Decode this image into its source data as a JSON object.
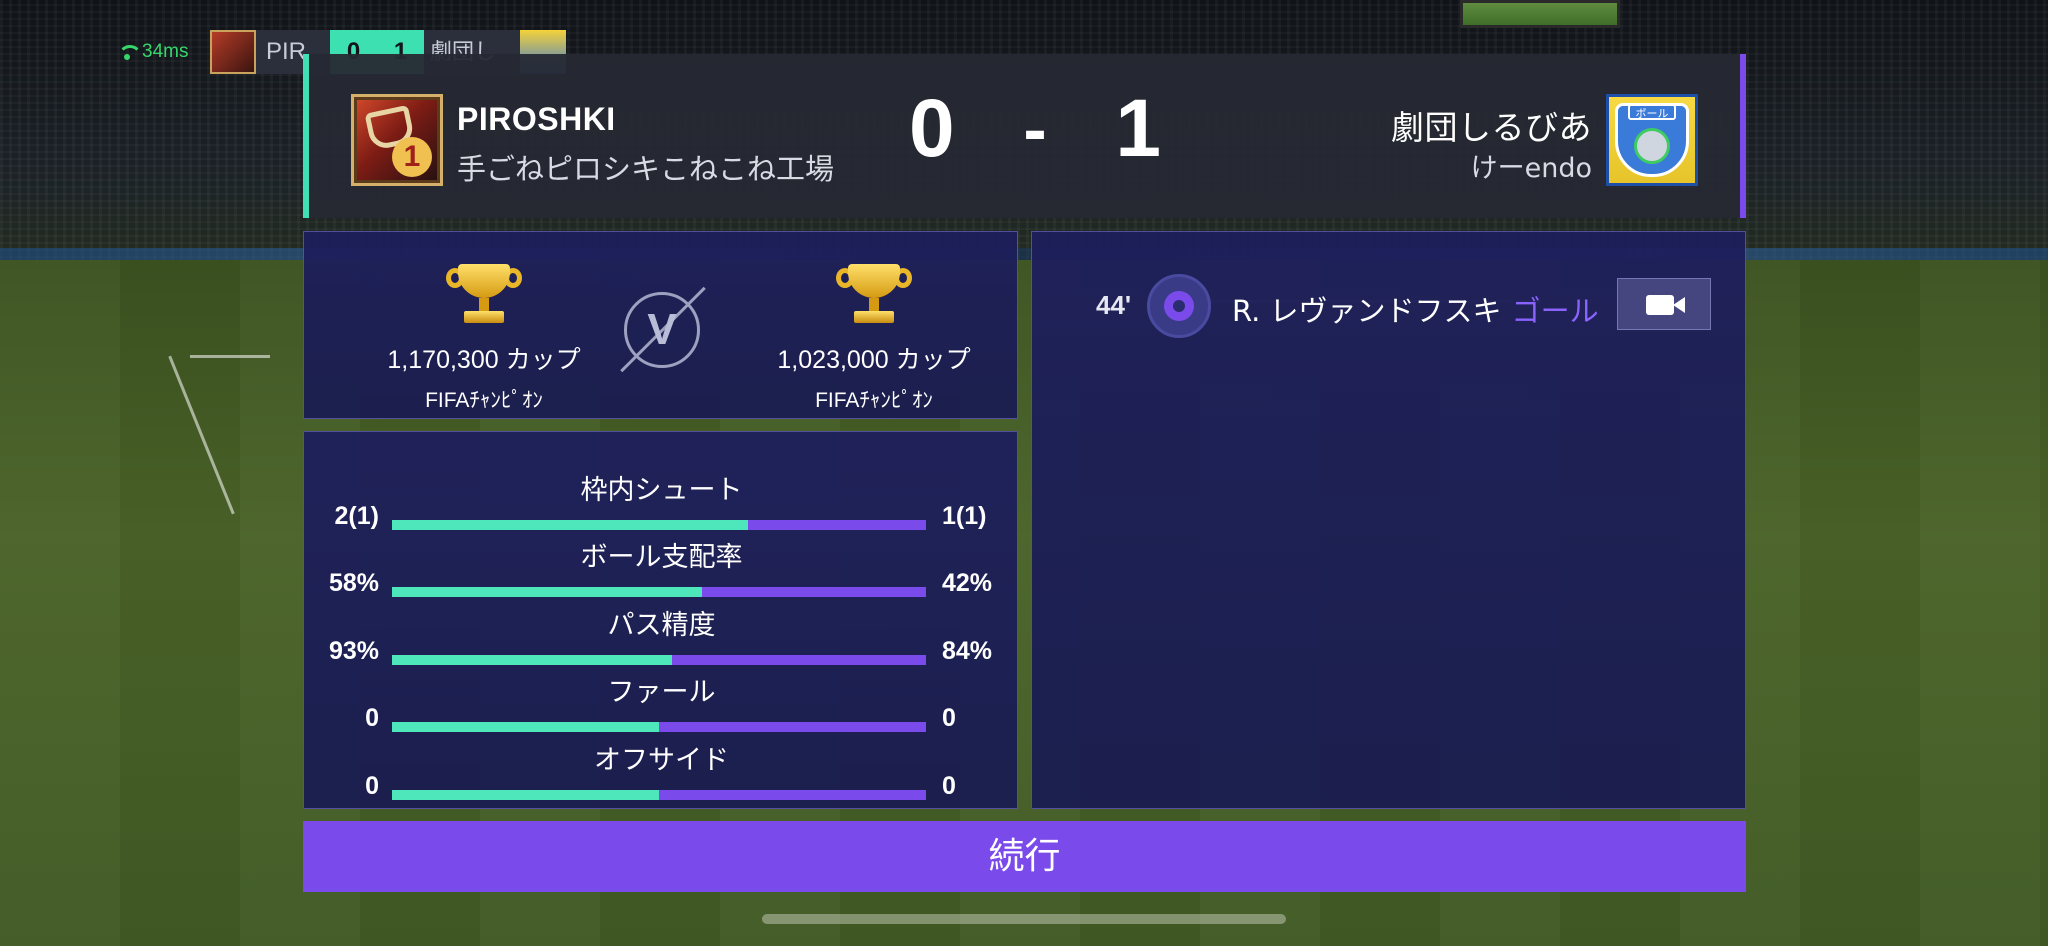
{
  "hud": {
    "ping": "34ms",
    "home_abbr": "PIR",
    "home_score": "0",
    "away_score": "1",
    "away_abbr": "劇団し"
  },
  "header": {
    "home": {
      "name": "PIROSHKI",
      "subtitle": "手ごねピロシキこねこね工場",
      "badge_number": "1"
    },
    "away": {
      "name": "劇団しるびあ",
      "subtitle": "けーendo",
      "badge_tag": "ボール"
    },
    "score": {
      "home": "0",
      "separator": "-",
      "away": "1"
    }
  },
  "cups": {
    "home": {
      "count": "1,170,300 カップ",
      "rank": "FIFAﾁｬﾝﾋﾟｵﾝ"
    },
    "away": {
      "count": "1,023,000 カップ",
      "rank": "FIFAﾁｬﾝﾋﾟｵﾝ"
    },
    "vs_label": "V"
  },
  "stats": [
    {
      "label": "枠内シュート",
      "home": "2(1)",
      "away": "1(1)",
      "home_share": 0.667
    },
    {
      "label": "ボール支配率",
      "home": "58%",
      "away": "42%",
      "home_share": 0.58
    },
    {
      "label": "パス精度",
      "home": "93%",
      "away": "84%",
      "home_share": 0.525
    },
    {
      "label": "ファール",
      "home": "0",
      "away": "0",
      "home_share": 0.5
    },
    {
      "label": "オフサイド",
      "home": "0",
      "away": "0",
      "home_share": 0.5
    }
  ],
  "events": [
    {
      "minute": "44'",
      "player": "R. レヴァンドフスキ",
      "type": "ゴール",
      "icon": "soccer-ball-icon"
    }
  ],
  "continue_label": "続行",
  "colors": {
    "home_accent": "#4ee7bc",
    "away_accent": "#7a4bea",
    "panel": "#1d1e5c",
    "header": "#262933"
  }
}
